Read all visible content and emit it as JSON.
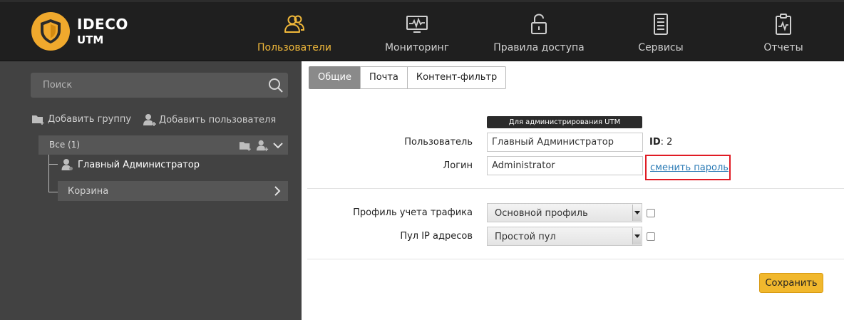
{
  "brand": {
    "name": "IDECO",
    "product": "UTM"
  },
  "nav": {
    "users": "Пользователи",
    "monitoring": "Мониторинг",
    "access_rules": "Правила доступа",
    "services": "Сервисы",
    "reports": "Отчеты",
    "active": "users"
  },
  "sidebar": {
    "search_placeholder": "Поиск",
    "add_group": "Добавить группу",
    "add_user": "Добавить пользователя",
    "group_all": "Все (1)",
    "user_name": "Главный Администратор",
    "trash": "Корзина"
  },
  "tabs": {
    "general": "Общие",
    "mail": "Почта",
    "content_filter": "Контент-фильтр",
    "active": "general"
  },
  "form": {
    "admin_badge": "Для администрирования UTM",
    "user_label": "Пользователь",
    "user_value": "Главный Администратор",
    "id_label": "ID",
    "id_value": ": 2",
    "login_label": "Логин",
    "login_value": "Administrator",
    "change_password": "сменить пароль",
    "traffic_profile_label": "Профиль учета трафика",
    "traffic_profile_value": "Основной профиль",
    "ip_pool_label": "Пул IP адресов",
    "ip_pool_value": "Простой пул",
    "save": "Сохранить"
  },
  "colors": {
    "accent": "#f0b83a",
    "topbar": "#1f1f1f",
    "sidebar": "#424242",
    "highlight": "#e01b24"
  }
}
